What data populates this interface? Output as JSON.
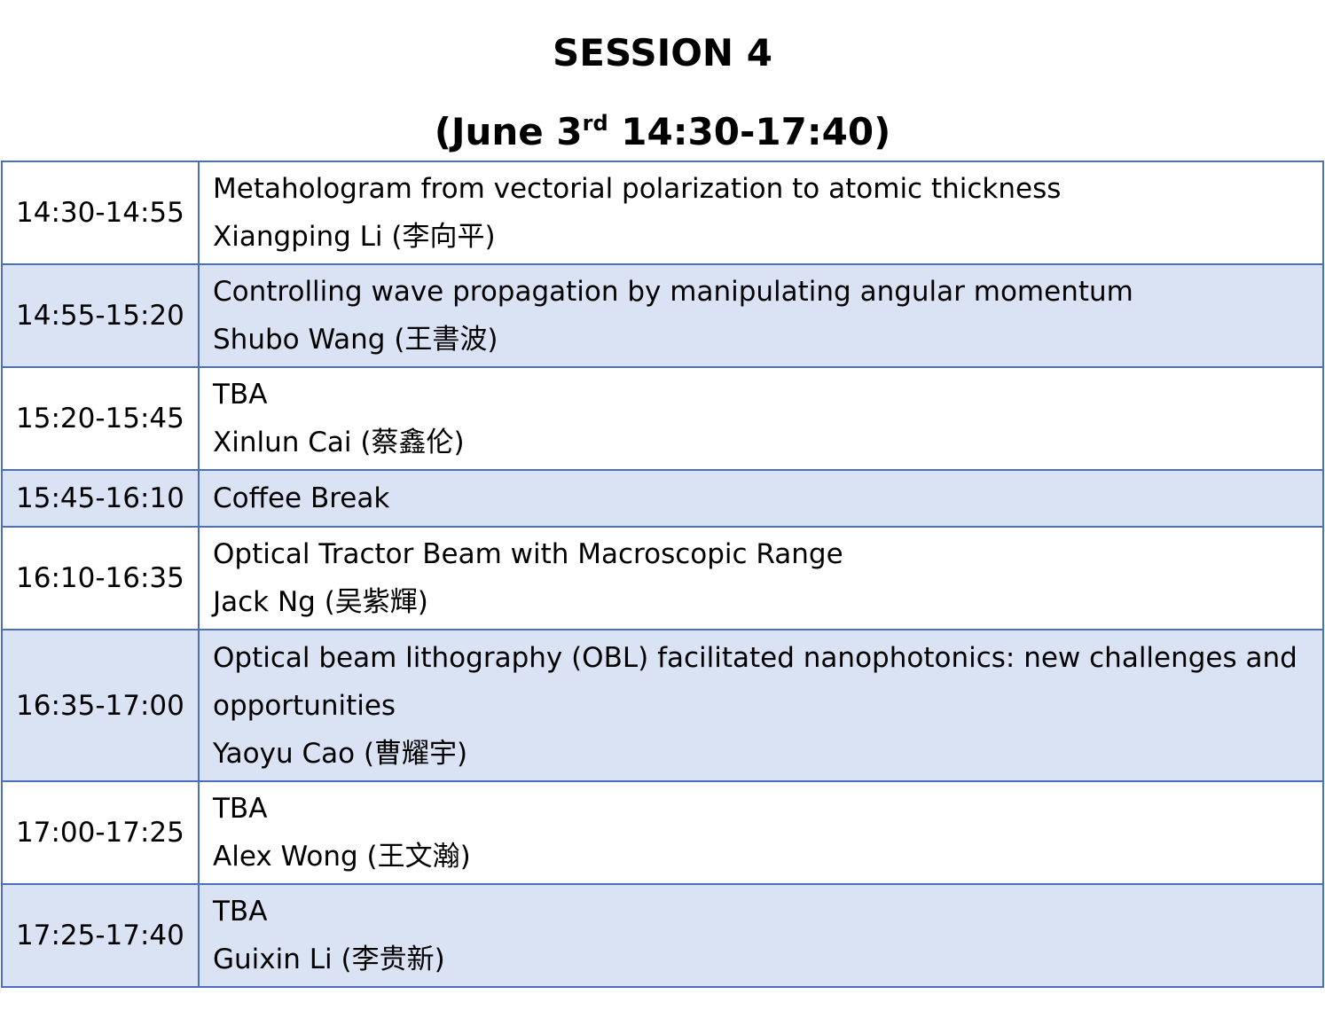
{
  "header": {
    "title": "SESSION 4",
    "date_open": "(June 3",
    "date_sup": "rd",
    "date_close": " 14:30-17:40)"
  },
  "rows": [
    {
      "time": "14:30-14:55",
      "title": "Metahologram from vectorial polarization to atomic thickness",
      "speaker": "Xiangping Li (李向平)"
    },
    {
      "time": "14:55-15:20",
      "title": "Controlling wave propagation by manipulating angular momentum",
      "speaker": "Shubo Wang (王書波)"
    },
    {
      "time": "15:20-15:45",
      "title": "TBA",
      "speaker": "Xinlun Cai (蔡鑫伦)"
    },
    {
      "time": "15:45-16:10",
      "title": "Coffee Break"
    },
    {
      "time": "16:10-16:35",
      "title": "Optical Tractor Beam with Macroscopic Range",
      "speaker": "Jack Ng (吴紫輝)"
    },
    {
      "time": "16:35-17:00",
      "title": "Optical beam lithography (OBL) facilitated nanophotonics: new challenges and opportunities",
      "speaker": "Yaoyu Cao (曹耀宇)"
    },
    {
      "time": "17:00-17:25",
      "title": "TBA",
      "speaker": "Alex Wong (王文瀚)"
    },
    {
      "time": "17:25-17:40",
      "title": "TBA",
      "speaker": "Guixin Li (李贵新)"
    }
  ],
  "colors": {
    "border": "#4a6fbf",
    "row_shade": "#dae3f3",
    "row_plain": "#ffffff"
  }
}
